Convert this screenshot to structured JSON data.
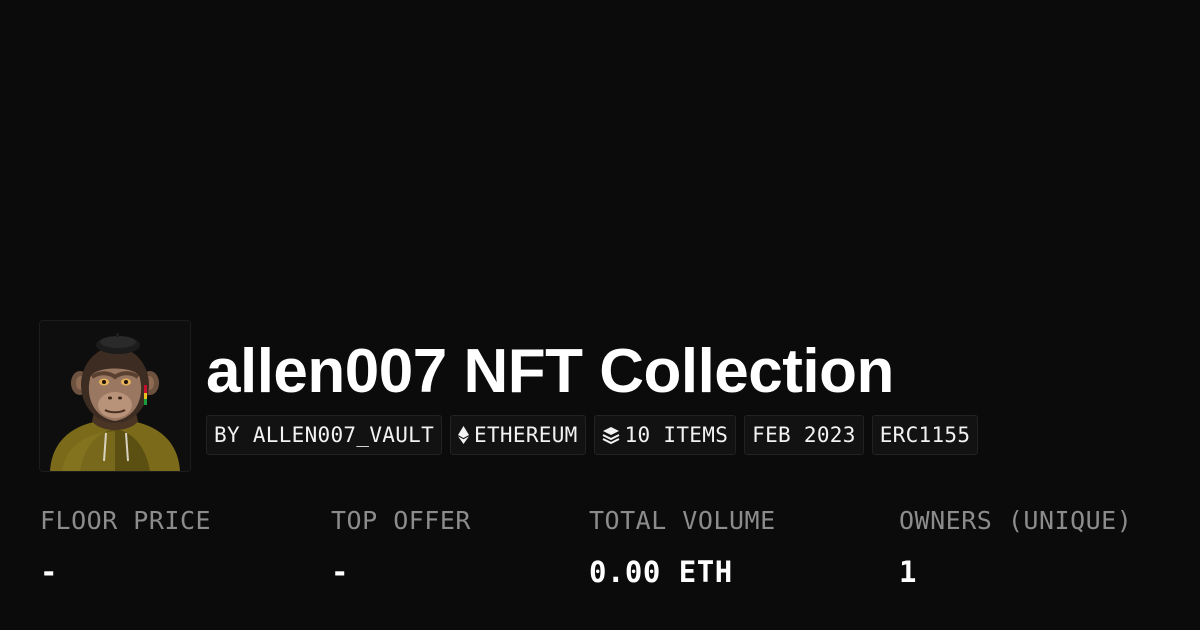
{
  "collection": {
    "title": "allen007 NFT Collection",
    "avatar_alt": "Ape wearing a beret and hoodie"
  },
  "badges": [
    {
      "label": "BY ALLEN007_VAULT",
      "icon": null
    },
    {
      "label": "ETHEREUM",
      "icon": "ethereum-icon"
    },
    {
      "label": "10 ITEMS",
      "icon": "layers-icon"
    },
    {
      "label": "FEB 2023",
      "icon": null
    },
    {
      "label": "ERC1155",
      "icon": null
    }
  ],
  "stats": [
    {
      "label": "FLOOR PRICE",
      "value": "-"
    },
    {
      "label": "TOP OFFER",
      "value": "-"
    },
    {
      "label": "TOTAL VOLUME",
      "value": "0.00 ETH"
    },
    {
      "label": "OWNERS (UNIQUE)",
      "value": "1"
    }
  ],
  "colors": {
    "background": "#0b0b0b",
    "text": "#ffffff",
    "muted": "#8c8c8c",
    "badge_bg": "#121212",
    "badge_border": "#222222"
  }
}
